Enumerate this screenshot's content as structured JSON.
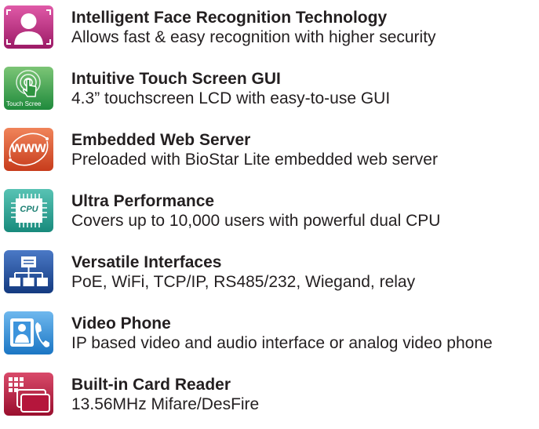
{
  "features": [
    {
      "icon": "face-recognition-icon",
      "title": "Intelligent Face Recognition Technology",
      "desc": "Allows fast & easy recognition with higher security"
    },
    {
      "icon": "touch-screen-icon",
      "icon_caption": "Touch Scree",
      "title": "Intuitive Touch Screen GUI",
      "desc": "4.3” touchscreen LCD with easy-to-use GUI"
    },
    {
      "icon": "web-server-icon",
      "icon_caption": "www",
      "title": "Embedded Web Server",
      "desc": "Preloaded with BioStar Lite embedded web server"
    },
    {
      "icon": "cpu-icon",
      "icon_caption": "CPU",
      "title": "Ultra Performance",
      "desc": "Covers up to 10,000 users with powerful dual CPU"
    },
    {
      "icon": "network-interfaces-icon",
      "title": "Versatile Interfaces",
      "desc": "PoE, WiFi, TCP/IP, RS485/232, Wiegand, relay"
    },
    {
      "icon": "video-phone-icon",
      "title": "Video Phone",
      "desc": "IP based video and audio interface or analog video phone"
    },
    {
      "icon": "card-reader-icon",
      "title": "Built-in Card Reader",
      "desc": "13.56MHz Mifare/DesFire"
    }
  ],
  "colors": {
    "face": "#c0287f",
    "touch": "#3ea64a",
    "web": "#e1542b",
    "cpu": "#2aa598",
    "interfaces": "#1e4d9c",
    "phone": "#2b8ed6",
    "card": "#b5163c"
  }
}
